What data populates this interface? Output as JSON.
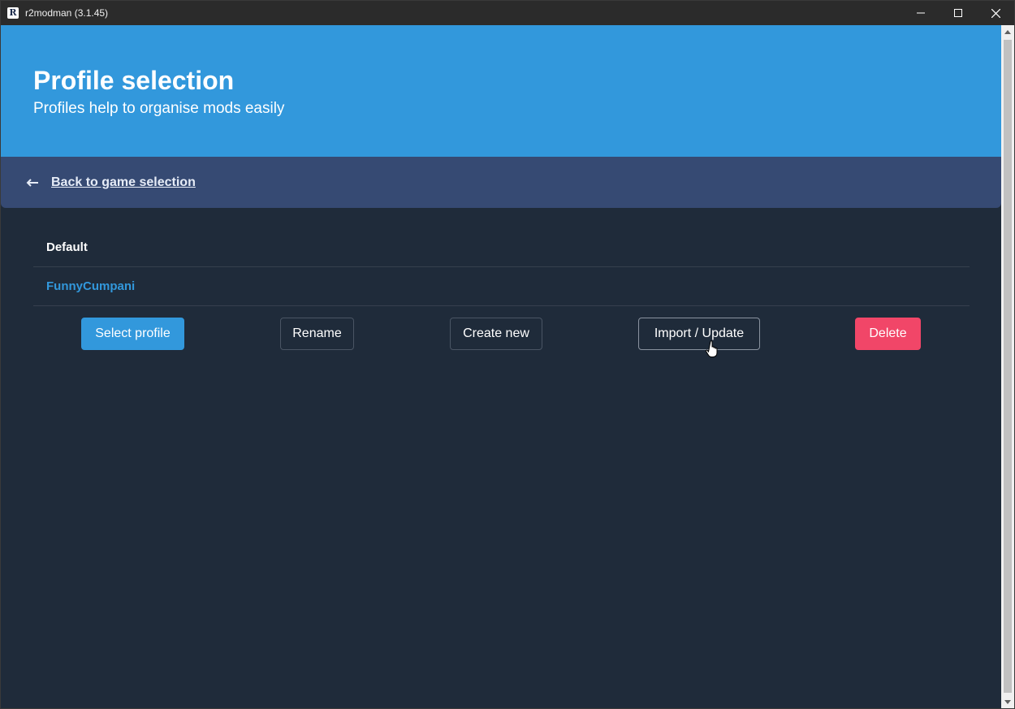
{
  "window": {
    "title": "r2modman (3.1.45)",
    "app_icon_letter": "R"
  },
  "header": {
    "title": "Profile selection",
    "subtitle": "Profiles help to organise mods easily"
  },
  "navigation": {
    "back_label": "Back to game selection"
  },
  "profiles": [
    {
      "name": "Default",
      "selected": false
    },
    {
      "name": "FunnyCumpani",
      "selected": true
    }
  ],
  "actions": {
    "select": "Select profile",
    "rename": "Rename",
    "create": "Create new",
    "import": "Import / Update",
    "delete": "Delete"
  },
  "colors": {
    "primary": "#3298dc",
    "danger": "#f14668",
    "backbar": "#364a73",
    "background": "#1f2b3a"
  }
}
